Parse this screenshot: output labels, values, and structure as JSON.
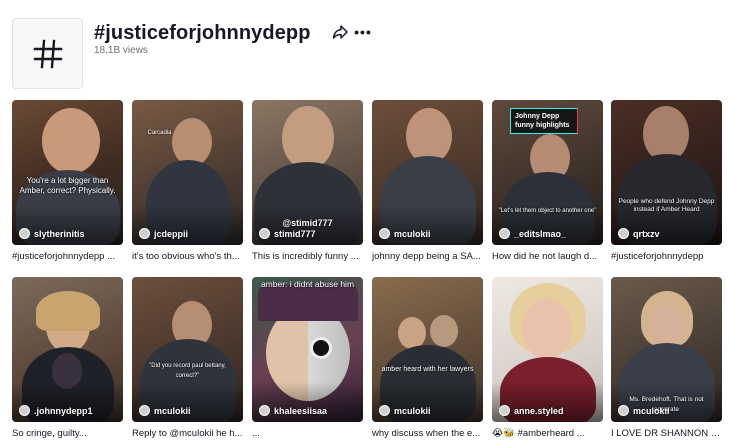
{
  "header": {
    "title": "#justiceforjohnnydepp",
    "views": "18.1B views",
    "icon": "hashtag-icon"
  },
  "colors": {
    "text": "#161823",
    "secondary": "#6e6f77",
    "accent_cyan": "#2af0ea",
    "accent_red": "#fe2c55"
  },
  "videos": [
    {
      "author": "slytherinitis",
      "caption": "#justiceforjohnnydepp ...",
      "overlay": "You're a lot bigger than Amber, correct? Physically."
    },
    {
      "author": "jcdeppii",
      "caption": "it's too obvious who's th...",
      "overlay": "Carcadia"
    },
    {
      "author": "stimid777",
      "caption": "This is incredibly funny ...",
      "overlay": "@stimid777"
    },
    {
      "author": "mculokii",
      "caption": "johnny depp being a SA...",
      "overlay": ""
    },
    {
      "author": "_editslmao_",
      "caption": "How did he not laugh d...",
      "overlay": "\"Let's let them object to another one\"",
      "badge": "Johnny Depp funny highlights"
    },
    {
      "author": "qrtxzv",
      "caption": "#justiceforjohnnydepp",
      "overlay": "People who defend Johnny Depp instead if Amber Heard"
    },
    {
      "author": ".johnnydepp1",
      "caption": "So cringe, guilty...",
      "overlay": ""
    },
    {
      "author": "mculokii",
      "caption": "Reply to @mculokii he h...",
      "overlay": "\"Did you record paul bettany, correct?\""
    },
    {
      "author": "khaleesiisaa",
      "caption": "...",
      "overlay": "amber: i didnt abuse him"
    },
    {
      "author": "mculokii",
      "caption": "why discuss when the e...",
      "overlay": "amber heard with her lawyers"
    },
    {
      "author": "anne.styled",
      "caption": "😭🐝 #amberheard ...",
      "overlay": ""
    },
    {
      "author": "mculokii",
      "caption": "I LOVE DR SHANNON C...",
      "overlay": "Ms. Bredehoft. That is not accurate"
    }
  ]
}
